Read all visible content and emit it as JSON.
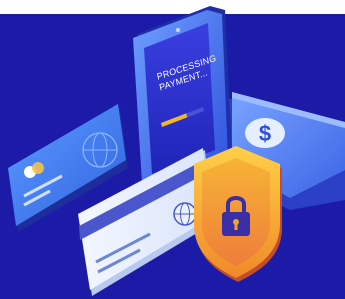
{
  "illustration": {
    "phone_screen": {
      "line1": "PROCESSING",
      "line2": "PAYMENT...",
      "progress": 0.6
    },
    "money_symbol": "$",
    "colors": {
      "background": "#1a1aa6",
      "phone_body": "#3b6bf0",
      "screen": "#2a2fd0",
      "progress_fill": "#f0b726",
      "card_left": "#4a86f2",
      "card_front": "#e9f0fb",
      "card_stripe": "#3f58c9",
      "cash": "#5a86f5",
      "shield_outer": "#f6b534",
      "shield_inner": "#f3a22c",
      "lock": "#3b2fa8"
    }
  }
}
